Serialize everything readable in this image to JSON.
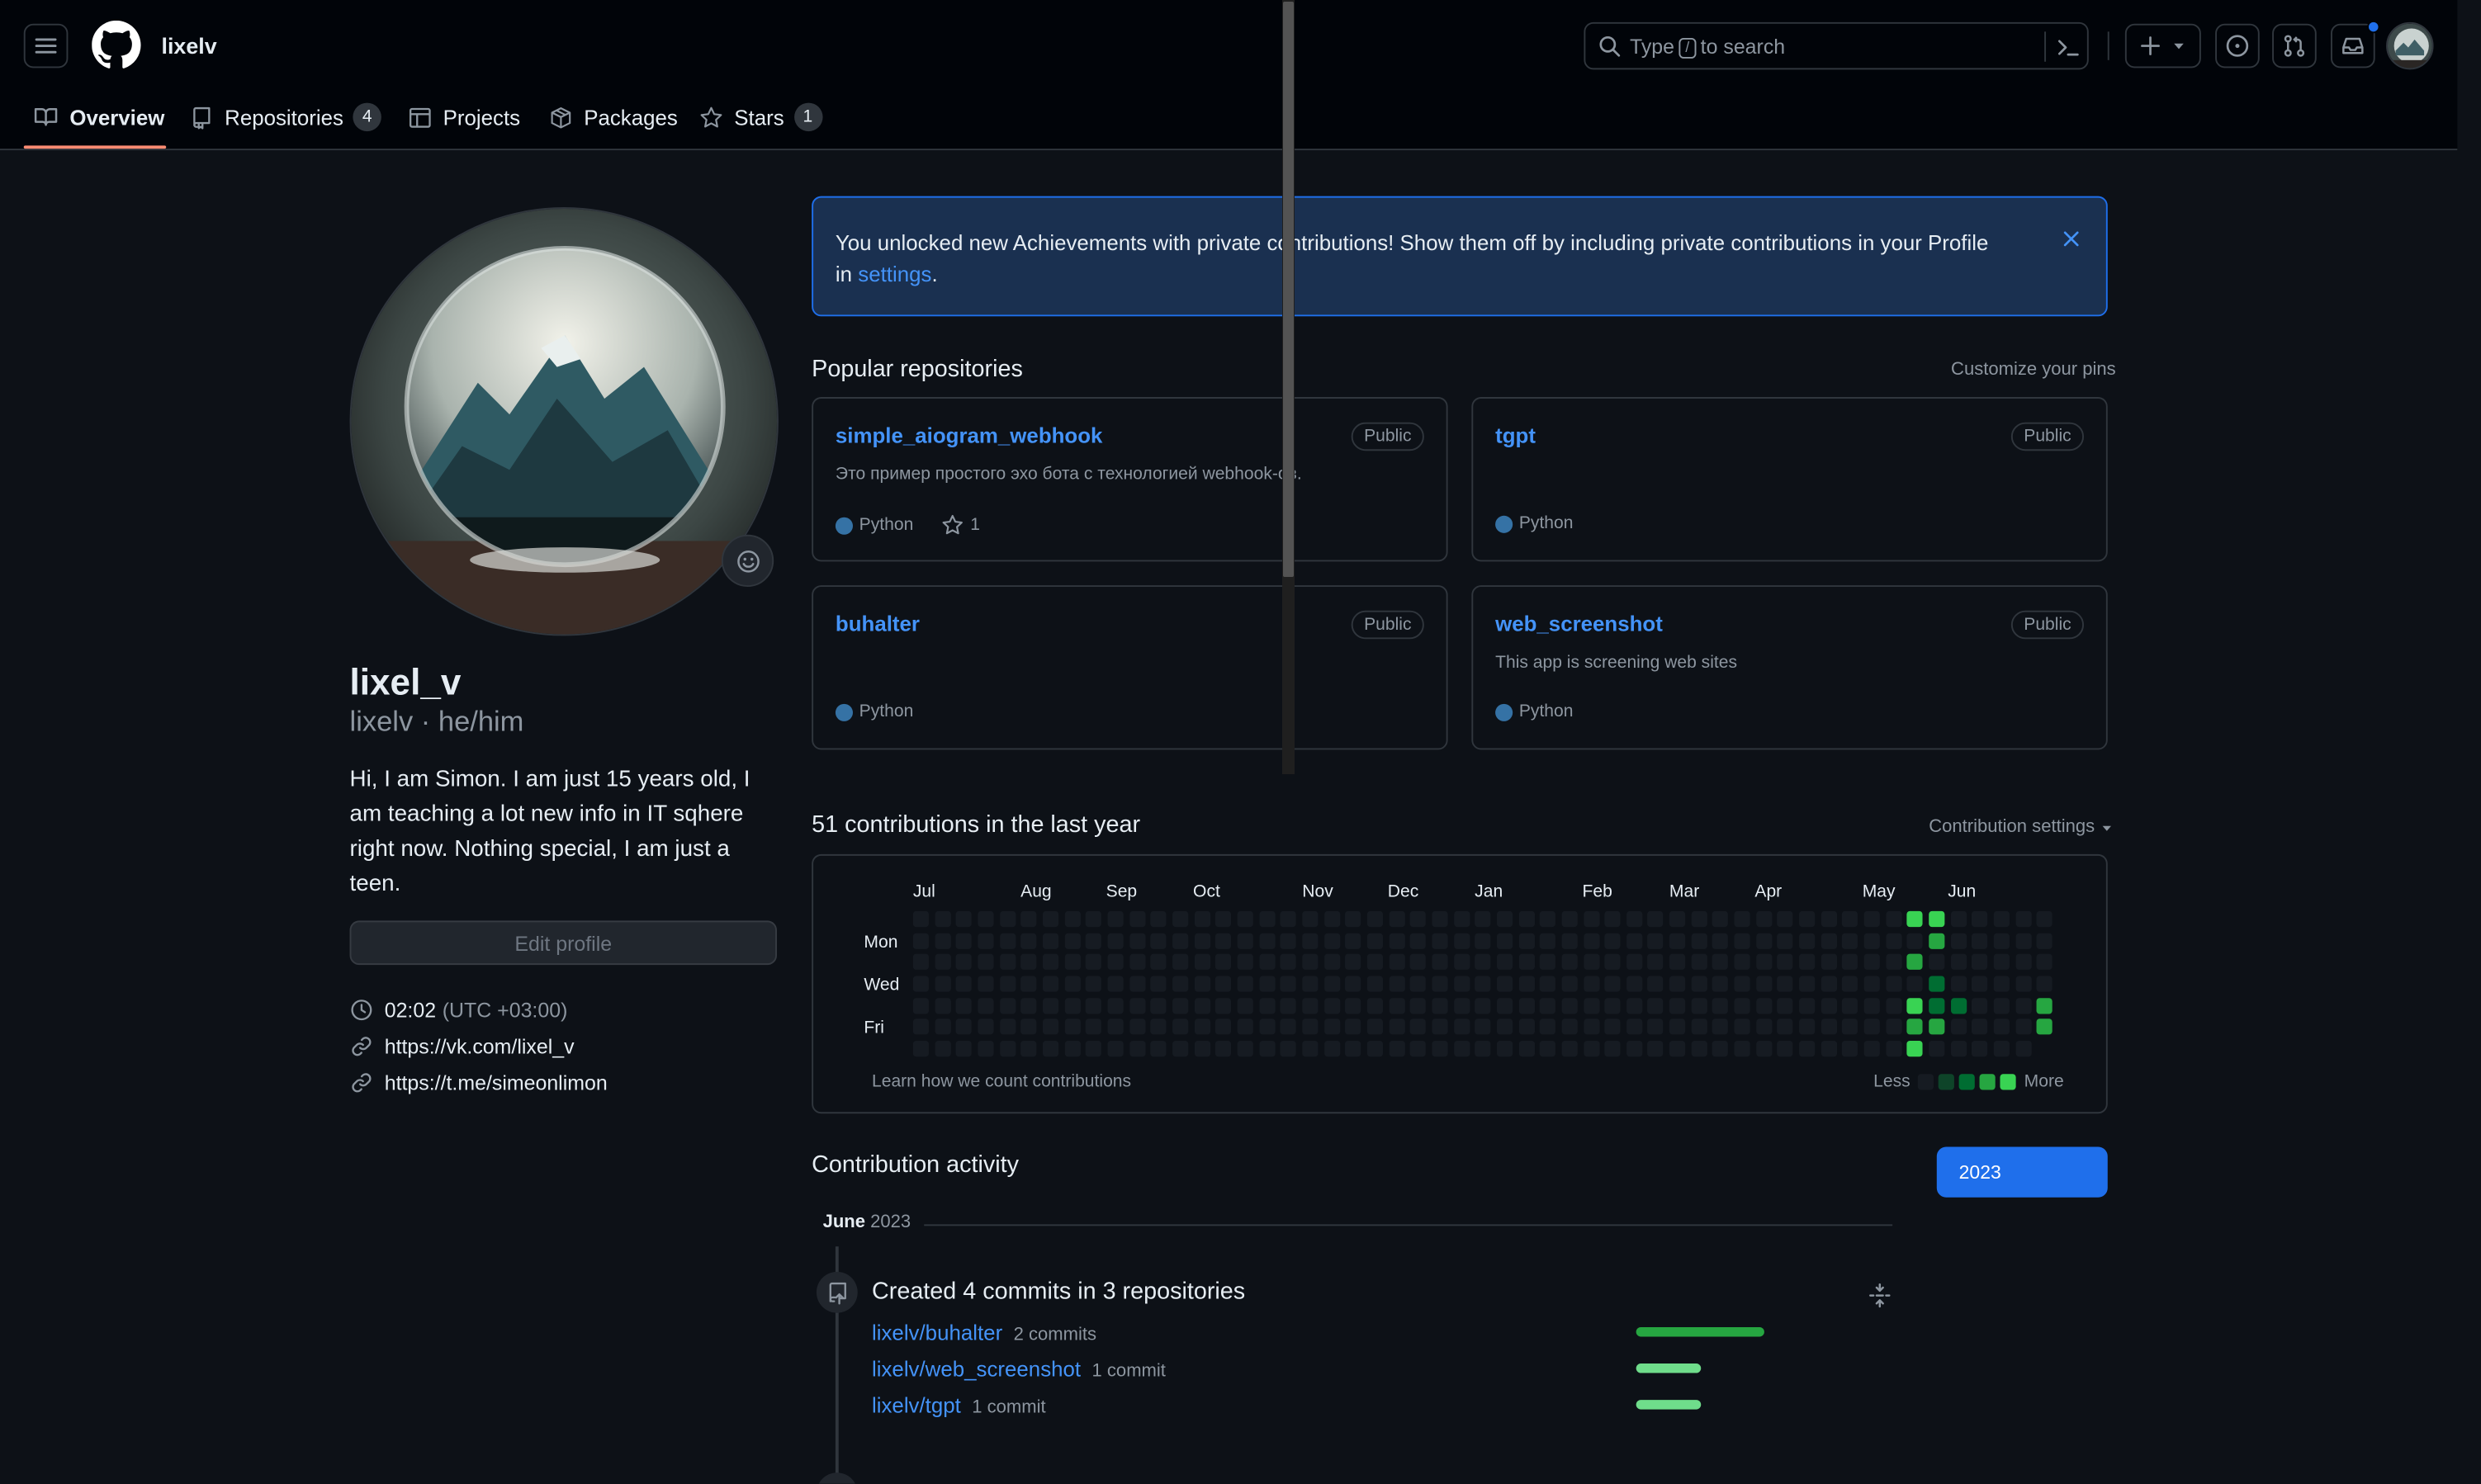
{
  "header": {
    "username": "lixelv",
    "search": {
      "prefix": "Type",
      "key": "/",
      "suffix": "to search"
    },
    "notification_dot": true
  },
  "tabs": [
    {
      "label": "Overview",
      "count": null,
      "icon": "book-icon",
      "selected": true
    },
    {
      "label": "Repositories",
      "count": "4",
      "icon": "repo-icon",
      "selected": false
    },
    {
      "label": "Projects",
      "count": null,
      "icon": "table-icon",
      "selected": false
    },
    {
      "label": "Packages",
      "count": null,
      "icon": "package-icon",
      "selected": false
    },
    {
      "label": "Stars",
      "count": "1",
      "icon": "star-icon",
      "selected": false
    }
  ],
  "profile": {
    "display_name": "lixel_v",
    "login_pronouns": "lixelv · he/him",
    "bio": "Hi, I am Simon. I am just 15 years old, I am teaching a lot new info in IT sqhere right now. Nothing special, I am just a teen.",
    "edit_label": "Edit profile",
    "time": "02:02",
    "timezone": "(UTC +03:00)",
    "links": [
      "https://vk.com/lixel_v",
      "https://t.me/simeonlimon"
    ]
  },
  "banner": {
    "text": "You unlocked new Achievements with private contributions! Show them off by including private contributions in your Profile in",
    "link": "settings",
    "end": "."
  },
  "popular": {
    "title": "Popular repositories",
    "customize": "Customize your pins",
    "repos": [
      {
        "name": "simple_aiogram_webhook",
        "visibility": "Public",
        "description": "Это пример простого эхо бота с технологией webhook-ов.",
        "language": "Python",
        "lang_color": "#3572A5",
        "stars": "1"
      },
      {
        "name": "tgpt",
        "visibility": "Public",
        "description": "",
        "language": "Python",
        "lang_color": "#3572A5",
        "stars": null
      },
      {
        "name": "buhalter",
        "visibility": "Public",
        "description": "",
        "language": "Python",
        "lang_color": "#3572A5",
        "stars": null
      },
      {
        "name": "web_screenshot",
        "visibility": "Public",
        "description": "This app is screening web sites",
        "language": "Python",
        "lang_color": "#3572A5",
        "stars": null
      }
    ]
  },
  "contributions": {
    "title": "51 contributions in the last year",
    "settings_label": "Contribution settings",
    "months": [
      "Jul",
      "Aug",
      "Sep",
      "Oct",
      "Nov",
      "Dec",
      "Jan",
      "Feb",
      "Mar",
      "Apr",
      "May",
      "Jun"
    ],
    "days": [
      "Mon",
      "Wed",
      "Fri"
    ],
    "learn": "Learn how we count contributions",
    "less": "Less",
    "more": "More",
    "colors": [
      "#161b22",
      "#0e4429",
      "#006d32",
      "#26a641",
      "#39d353"
    ],
    "weeks": 53,
    "last_week_days": 6,
    "active_cells": [
      {
        "week": 46,
        "day": 0,
        "level": 4
      },
      {
        "week": 46,
        "day": 2,
        "level": 3
      },
      {
        "week": 46,
        "day": 4,
        "level": 4
      },
      {
        "week": 46,
        "day": 5,
        "level": 3
      },
      {
        "week": 46,
        "day": 6,
        "level": 4
      },
      {
        "week": 47,
        "day": 0,
        "level": 4
      },
      {
        "week": 47,
        "day": 1,
        "level": 3
      },
      {
        "week": 47,
        "day": 3,
        "level": 2
      },
      {
        "week": 47,
        "day": 4,
        "level": 2
      },
      {
        "week": 47,
        "day": 5,
        "level": 3
      },
      {
        "week": 48,
        "day": 4,
        "level": 2
      },
      {
        "week": 52,
        "day": 4,
        "level": 3
      },
      {
        "week": 52,
        "day": 5,
        "level": 3
      }
    ]
  },
  "activity": {
    "title": "Contribution activity",
    "year": "2023",
    "month": "June",
    "month_year": "2023",
    "summary": "Created 4 commits in 3 repositories",
    "repos": [
      {
        "name": "lixelv/buhalter",
        "commits": "2 commits",
        "share": 1.0
      },
      {
        "name": "lixelv/web_screenshot",
        "commits": "1 commit",
        "share": 0.5
      },
      {
        "name": "lixelv/tgpt",
        "commits": "1 commit",
        "share": 0.5
      }
    ]
  }
}
